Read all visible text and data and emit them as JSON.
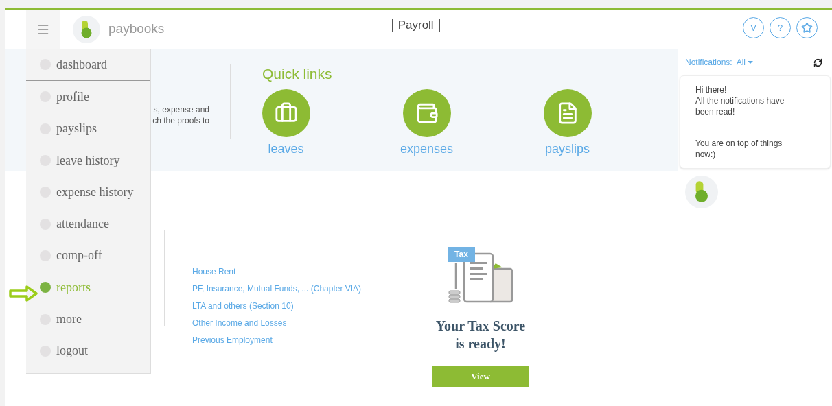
{
  "header": {
    "brand": "paybooks",
    "title": "Payroll",
    "user_initial": "V",
    "help": "?"
  },
  "menu": {
    "items": [
      {
        "label": "dashboard",
        "selected": false
      },
      {
        "label": "profile",
        "selected": false
      },
      {
        "label": "payslips",
        "selected": false
      },
      {
        "label": "leave history",
        "selected": false
      },
      {
        "label": "expense history",
        "selected": false
      },
      {
        "label": "attendance",
        "selected": false
      },
      {
        "label": "comp-off",
        "selected": false
      },
      {
        "label": "reports",
        "selected": true
      },
      {
        "label": "more",
        "selected": false
      },
      {
        "label": "logout",
        "selected": false
      }
    ]
  },
  "intro": {
    "lines": [
      "s, expense and",
      "ch the proofs to"
    ]
  },
  "quick_links": {
    "title": "Quick links",
    "links": [
      {
        "label": "leaves",
        "kind": "suitcase"
      },
      {
        "label": "expenses",
        "kind": "wallet"
      },
      {
        "label": "payslips",
        "kind": "document"
      }
    ]
  },
  "tax_sections": [
    "House Rent",
    "PF, Insurance, Mutual Funds, ... (Chapter VIA)",
    "LTA and others (Section 10)",
    "Other Income and Losses",
    "Previous Employment"
  ],
  "tax_card": {
    "badge": "Tax",
    "heading_lines": [
      "Your Tax Score",
      "is ready!"
    ],
    "button": "View"
  },
  "notifications": {
    "label": "Notifications:",
    "filter": "All",
    "messages": [
      "Hi there!\nAll the notifications have been read!",
      "You are on top of things now:)"
    ]
  }
}
